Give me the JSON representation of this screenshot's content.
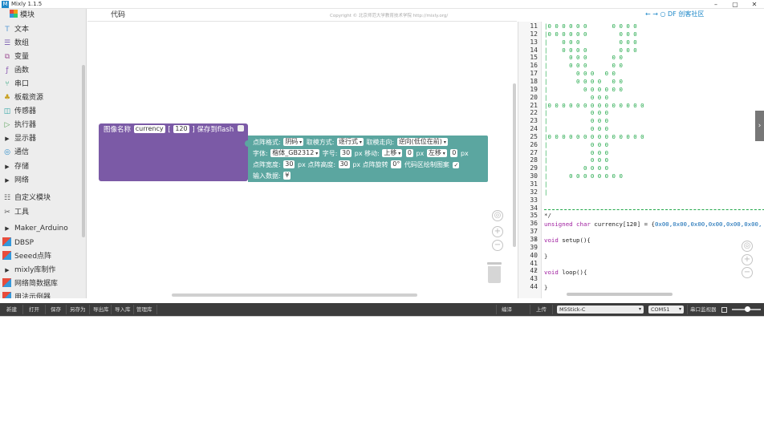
{
  "window": {
    "title": "Mixly 1.1.5",
    "app_icon": "M",
    "minimize": "–",
    "maximize": "▢",
    "close": "✕"
  },
  "sidebar": {
    "header": "模块",
    "items": [
      {
        "label": "文本",
        "icon": "text-icon",
        "glyph": "T",
        "color": "#5a9bd5"
      },
      {
        "label": "数组",
        "icon": "list-icon",
        "glyph": "☰",
        "color": "#7a5cb0"
      },
      {
        "label": "变量",
        "icon": "variable-icon",
        "glyph": "⧉",
        "color": "#a45a9b"
      },
      {
        "label": "函数",
        "icon": "function-icon",
        "glyph": "ƒ",
        "color": "#8b5ab0"
      },
      {
        "label": "串口",
        "icon": "serial-icon",
        "glyph": "⑂",
        "color": "#2aa27a"
      },
      {
        "label": "板载资源",
        "icon": "board-icon",
        "glyph": "♣",
        "color": "#c8a020"
      },
      {
        "label": "传感器",
        "icon": "sensor-icon",
        "glyph": "◫",
        "color": "#2aa2a2"
      },
      {
        "label": "执行器",
        "icon": "actuator-icon",
        "glyph": "▷",
        "color": "#5aa25a"
      },
      {
        "label": "显示器",
        "icon": "arrow-right-icon",
        "glyph": "▶",
        "color": "#333"
      },
      {
        "label": "通信",
        "icon": "communication-icon",
        "glyph": "◎",
        "color": "#2a8ac8"
      },
      {
        "label": "存储",
        "icon": "arrow-right-icon",
        "glyph": "▶",
        "color": "#333"
      },
      {
        "label": "网络",
        "icon": "arrow-right-icon",
        "glyph": "▶",
        "color": "#333"
      },
      {
        "label": "自定义模块",
        "icon": "custom-module-icon",
        "glyph": "☷",
        "color": "#555"
      },
      {
        "label": "工具",
        "icon": "tools-icon",
        "glyph": "✂",
        "color": "#555"
      },
      {
        "label": "Maker_Arduino",
        "icon": "arrow-right-icon",
        "glyph": "▶",
        "color": "#333"
      },
      {
        "label": "DBSP",
        "icon": "library-icon",
        "glyph": "",
        "color": "#333"
      },
      {
        "label": "Seeed点阵",
        "icon": "library-icon",
        "glyph": "",
        "color": "#333"
      },
      {
        "label": "mixly库制作",
        "icon": "arrow-right-icon",
        "glyph": "▶",
        "color": "#333"
      },
      {
        "label": "网络简数据库",
        "icon": "library-icon",
        "glyph": "",
        "color": "#333"
      },
      {
        "label": "用法示例器",
        "icon": "library-icon",
        "glyph": "",
        "color": "#333"
      }
    ]
  },
  "tab": {
    "label": "代码"
  },
  "copyright": "Copyright © 北京师范大学教育技术学院 http://mixly.org/",
  "top_right_nav": "←  →  ○ DF 创客社区",
  "block_main": {
    "label": "图像名称",
    "name_value": "currency",
    "bracket_open": "[",
    "size_value": "120",
    "bracket_close": "]",
    "save_label": "保存到flash"
  },
  "block_params": {
    "dot_format_label": "点阵格式:",
    "dot_format_value": "阴码",
    "mode_label": "取模方式:",
    "mode_value": "逐行式",
    "direction_label": "取模走向:",
    "direction_value": "逆向(低位在前)",
    "font_label": "字体:",
    "font_value": "楷体_GB2312",
    "size_label": "字号:",
    "size_value": "30",
    "move_label": "px 移动:",
    "move_v_dir": "上移",
    "move_v_value": "0",
    "px_unit": "px",
    "move_h_dir": "左移",
    "move_h_value": "0",
    "px_unit_2": "px",
    "width_label": "点阵宽度:",
    "width_value": "30",
    "height_label": "px 点阵高度:",
    "height_value": "30",
    "rotate_label": "px 点阵旋转",
    "rotate_value": "0°",
    "draw_label": "代码区绘制图案",
    "input_label": "输入数据:",
    "input_value": "¥"
  },
  "code": {
    "line_numbers": [
      "11",
      "12",
      "13",
      "14",
      "15",
      "16",
      "17",
      "18",
      "19",
      "20",
      "21",
      "22",
      "23",
      "24",
      "25",
      "26",
      "27",
      "28",
      "29",
      "30",
      "31",
      "32",
      "33",
      "34",
      "35",
      "36",
      "37",
      "38",
      "39",
      "40",
      "41",
      "42",
      "43",
      "44"
    ],
    "fold_marks": {
      "38": "▾",
      "42": "▾"
    },
    "art_lines": [
      "|0 0 0 0 0 0       0 0 0 0",
      "|0 0 0 0 0 0         0 0 0",
      "|    0 0 0           0 0 0",
      "|    0 0 0 0         0 0 0",
      "|      0 0 0       0 0",
      "|      0 0 0       0 0",
      "|        0 0 0   0 0",
      "|        0 0 0 0   0 0",
      "|          0 0 0 0 0 0",
      "|            0 0 0",
      "|0 0 0 0 0 0 0 0 0 0 0 0 0 0",
      "|            0 0 0",
      "|            0 0 0",
      "|            0 0 0",
      "|0 0 0 0 0 0 0 0 0 0 0 0 0 0",
      "|            0 0 0",
      "|            0 0 0",
      "|            0 0 0",
      "|          0 0 0 0",
      "|      0 0 0 0 0 0 0 0",
      "|",
      "|",
      "",
      ""
    ],
    "comment_end": "*/",
    "decl_kw": "unsigned char",
    "decl_rest": " currency[120] = {",
    "decl_values": "0x00,0x00,0x00,0x00,0x00,0x00,",
    "setup_kw": "void",
    "setup_rest": " setup(){",
    "close1": "}",
    "loop_kw": "void",
    "loop_rest": " loop(){",
    "close2": "}",
    "expand_glyph": "›"
  },
  "workspace_controls": {
    "center": "◎",
    "zoom_in": "+",
    "zoom_out": "−"
  },
  "toolbar": {
    "new": "新建",
    "open": "打开",
    "save": "保存",
    "save_as": "另存为",
    "export_lib": "导出库",
    "import_lib": "导入库",
    "manage_lib": "管理库",
    "compile": "编译",
    "upload": "上传",
    "board": "M5Stick-C",
    "port": "COM51",
    "serial_monitor": "串口监视器"
  }
}
